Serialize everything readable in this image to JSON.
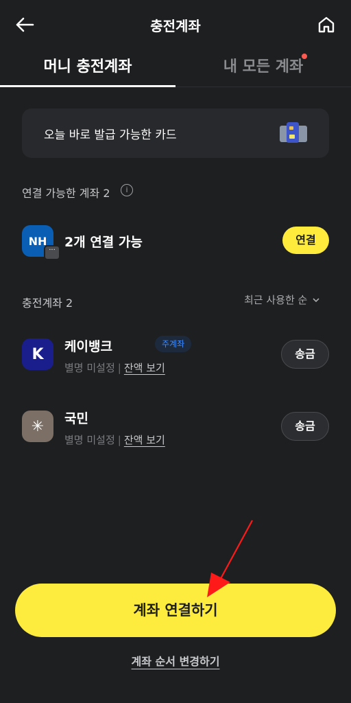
{
  "header": {
    "title": "충전계좌",
    "back_icon": "arrow-left-icon",
    "home_icon": "home-icon"
  },
  "tabs": [
    {
      "label": "머니 충전계좌",
      "active": true
    },
    {
      "label": "내 모든 계좌",
      "active": false,
      "has_notification_dot": true
    }
  ],
  "banner": {
    "text": "오늘 바로 발급 가능한 카드",
    "icon": "card-icon"
  },
  "connectable": {
    "label": "연결 가능한 계좌",
    "count": "2",
    "info_icon": "i",
    "bank_logo_text": "NH",
    "more_glyph": "···",
    "item_text": "2개 연결 가능",
    "button_label": "연결"
  },
  "charging": {
    "label": "충전계좌",
    "count": "2",
    "sort_label": "최근 사용한 순",
    "accounts": [
      {
        "logo_text": "K",
        "name": "케이뱅크",
        "badge": "주계좌",
        "nickname": "별명 미설정",
        "separator": "|",
        "balance_link": "잔액 보기",
        "send_label": "송금"
      },
      {
        "logo_text": "✳",
        "name": "국민",
        "badge": "",
        "nickname": "별명 미설정",
        "separator": "|",
        "balance_link": "잔액 보기",
        "send_label": "송금"
      }
    ]
  },
  "actions": {
    "primary": "계좌 연결하기",
    "secondary": "계좌 순서 변경하기"
  },
  "colors": {
    "accent_yellow": "#fdeb3d",
    "background": "#1e1f21",
    "annotation_red": "#ff1a1a",
    "badge_blue": "#3f8cff"
  }
}
